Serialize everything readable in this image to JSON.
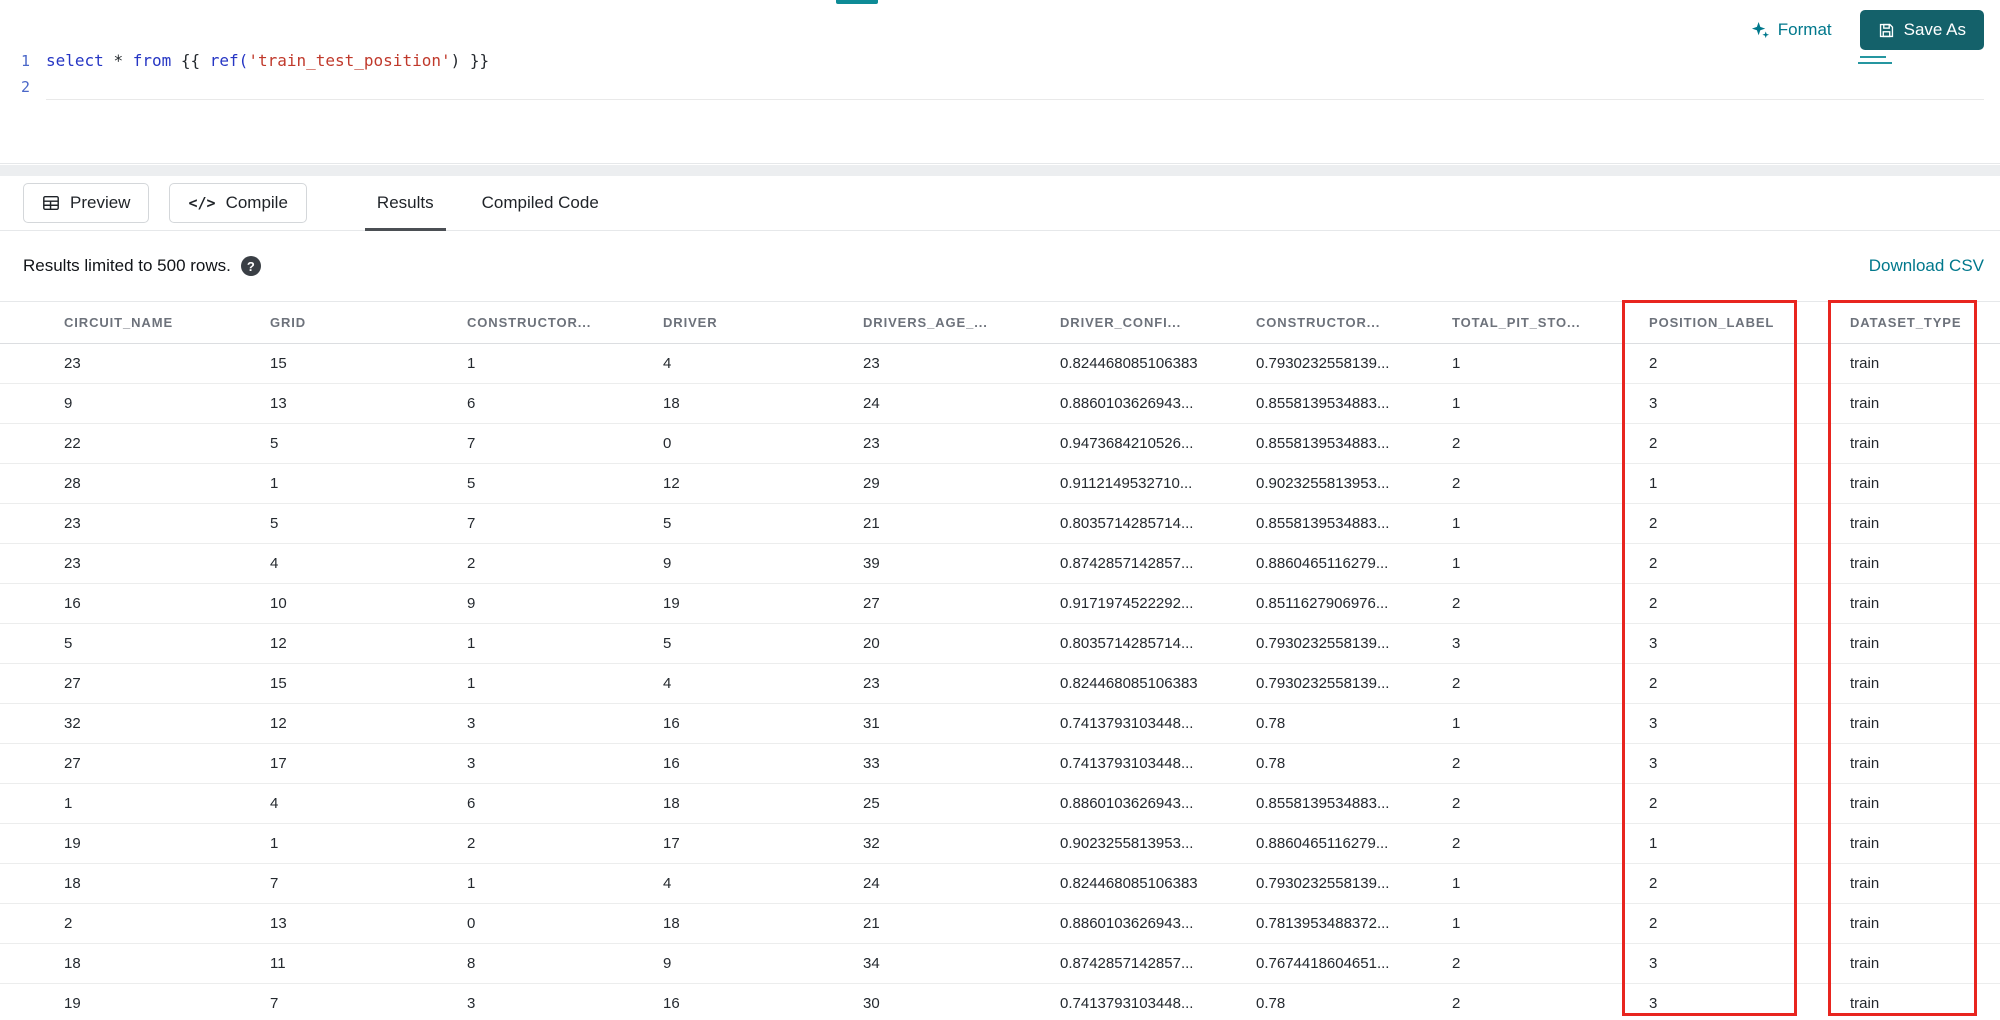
{
  "editor": {
    "lines": [
      {
        "number": "1",
        "tokens": [
          {
            "text": "select ",
            "type": "kw"
          },
          {
            "text": "* ",
            "type": "op"
          },
          {
            "text": "from ",
            "type": "kw"
          },
          {
            "text": "{{ ",
            "type": "pl"
          },
          {
            "text": "ref(",
            "type": "fn"
          },
          {
            "text": "'train_test_position'",
            "type": "str"
          },
          {
            "text": ") }}",
            "type": "pl"
          }
        ]
      },
      {
        "number": "2",
        "tokens": []
      }
    ]
  },
  "header_actions": {
    "format_label": "Format",
    "save_as_label": "Save As"
  },
  "toolbar": {
    "preview_label": "Preview",
    "compile_label": "Compile",
    "tabs": [
      {
        "label": "Results",
        "active": true
      },
      {
        "label": "Compiled Code",
        "active": false
      }
    ]
  },
  "results": {
    "limit_note": "Results limited to 500 rows.",
    "help_glyph": "?",
    "download_label": "Download CSV"
  },
  "table": {
    "columns": [
      "CIRCUIT_NAME",
      "GRID",
      "CONSTRUCTOR...",
      "DRIVER",
      "DRIVERS_AGE_...",
      "DRIVER_CONFI...",
      "CONSTRUCTOR...",
      "TOTAL_PIT_STO...",
      "POSITION_LABEL",
      "DATASET_TYPE"
    ],
    "rows": [
      [
        "23",
        "15",
        "1",
        "4",
        "23",
        "0.824468085106383",
        "0.7930232558139...",
        "1",
        "2",
        "train"
      ],
      [
        "9",
        "13",
        "6",
        "18",
        "24",
        "0.8860103626943...",
        "0.8558139534883...",
        "1",
        "3",
        "train"
      ],
      [
        "22",
        "5",
        "7",
        "0",
        "23",
        "0.9473684210526...",
        "0.8558139534883...",
        "2",
        "2",
        "train"
      ],
      [
        "28",
        "1",
        "5",
        "12",
        "29",
        "0.9112149532710...",
        "0.9023255813953...",
        "2",
        "1",
        "train"
      ],
      [
        "23",
        "5",
        "7",
        "5",
        "21",
        "0.8035714285714...",
        "0.8558139534883...",
        "1",
        "2",
        "train"
      ],
      [
        "23",
        "4",
        "2",
        "9",
        "39",
        "0.8742857142857...",
        "0.8860465116279...",
        "1",
        "2",
        "train"
      ],
      [
        "16",
        "10",
        "9",
        "19",
        "27",
        "0.9171974522292...",
        "0.8511627906976...",
        "2",
        "2",
        "train"
      ],
      [
        "5",
        "12",
        "1",
        "5",
        "20",
        "0.8035714285714...",
        "0.7930232558139...",
        "3",
        "3",
        "train"
      ],
      [
        "27",
        "15",
        "1",
        "4",
        "23",
        "0.824468085106383",
        "0.7930232558139...",
        "2",
        "2",
        "train"
      ],
      [
        "32",
        "12",
        "3",
        "16",
        "31",
        "0.7413793103448...",
        "0.78",
        "1",
        "3",
        "train"
      ],
      [
        "27",
        "17",
        "3",
        "16",
        "33",
        "0.7413793103448...",
        "0.78",
        "2",
        "3",
        "train"
      ],
      [
        "1",
        "4",
        "6",
        "18",
        "25",
        "0.8860103626943...",
        "0.8558139534883...",
        "2",
        "2",
        "train"
      ],
      [
        "19",
        "1",
        "2",
        "17",
        "32",
        "0.9023255813953...",
        "0.8860465116279...",
        "2",
        "1",
        "train"
      ],
      [
        "18",
        "7",
        "1",
        "4",
        "24",
        "0.824468085106383",
        "0.7930232558139...",
        "1",
        "2",
        "train"
      ],
      [
        "2",
        "13",
        "0",
        "18",
        "21",
        "0.8860103626943...",
        "0.7813953488372...",
        "1",
        "2",
        "train"
      ],
      [
        "18",
        "11",
        "8",
        "9",
        "34",
        "0.8742857142857...",
        "0.7674418604651...",
        "2",
        "3",
        "train"
      ],
      [
        "19",
        "7",
        "3",
        "16",
        "30",
        "0.7413793103448...",
        "0.78",
        "2",
        "3",
        "train"
      ]
    ],
    "annotated_columns": [
      "POSITION_LABEL",
      "DATASET_TYPE"
    ]
  },
  "colors": {
    "accent": "#00788c",
    "accent-dark": "#14616a",
    "annotation": "#e8251f",
    "kw": "#2636c4",
    "str": "#c0392b",
    "lineno": "#4a67c8"
  }
}
